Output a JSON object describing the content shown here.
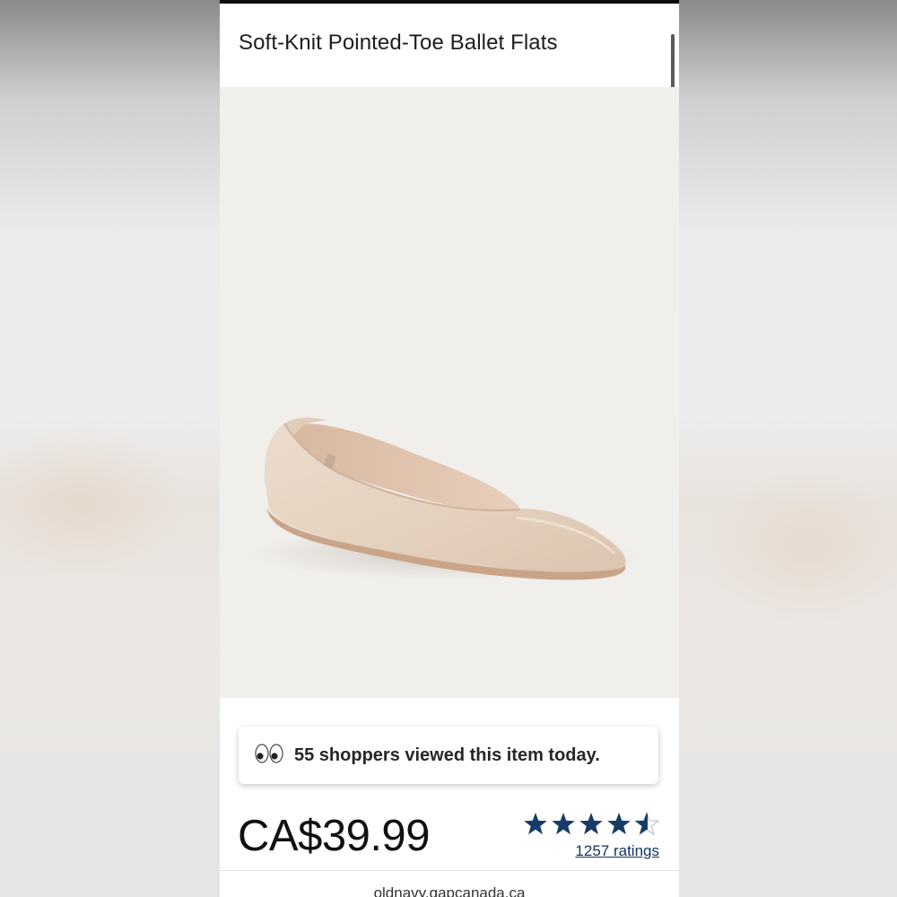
{
  "product": {
    "title": "Soft-Knit Pointed-Toe Ballet Flats",
    "image_subject": "shoe-image",
    "price": "CA$39.99"
  },
  "social_proof": {
    "icon": "eyes-icon",
    "text": "55 shoppers viewed this item today."
  },
  "rating": {
    "value": 4.5,
    "max": 5,
    "ratings_label": "1257 ratings",
    "star_color": "#163b68"
  },
  "footer": {
    "url": "oldnavy.gapcanada.ca"
  },
  "colors": {
    "accent": "#163b68",
    "image_background": "#f1efec",
    "shoe_knit": "#e6d3c2"
  }
}
